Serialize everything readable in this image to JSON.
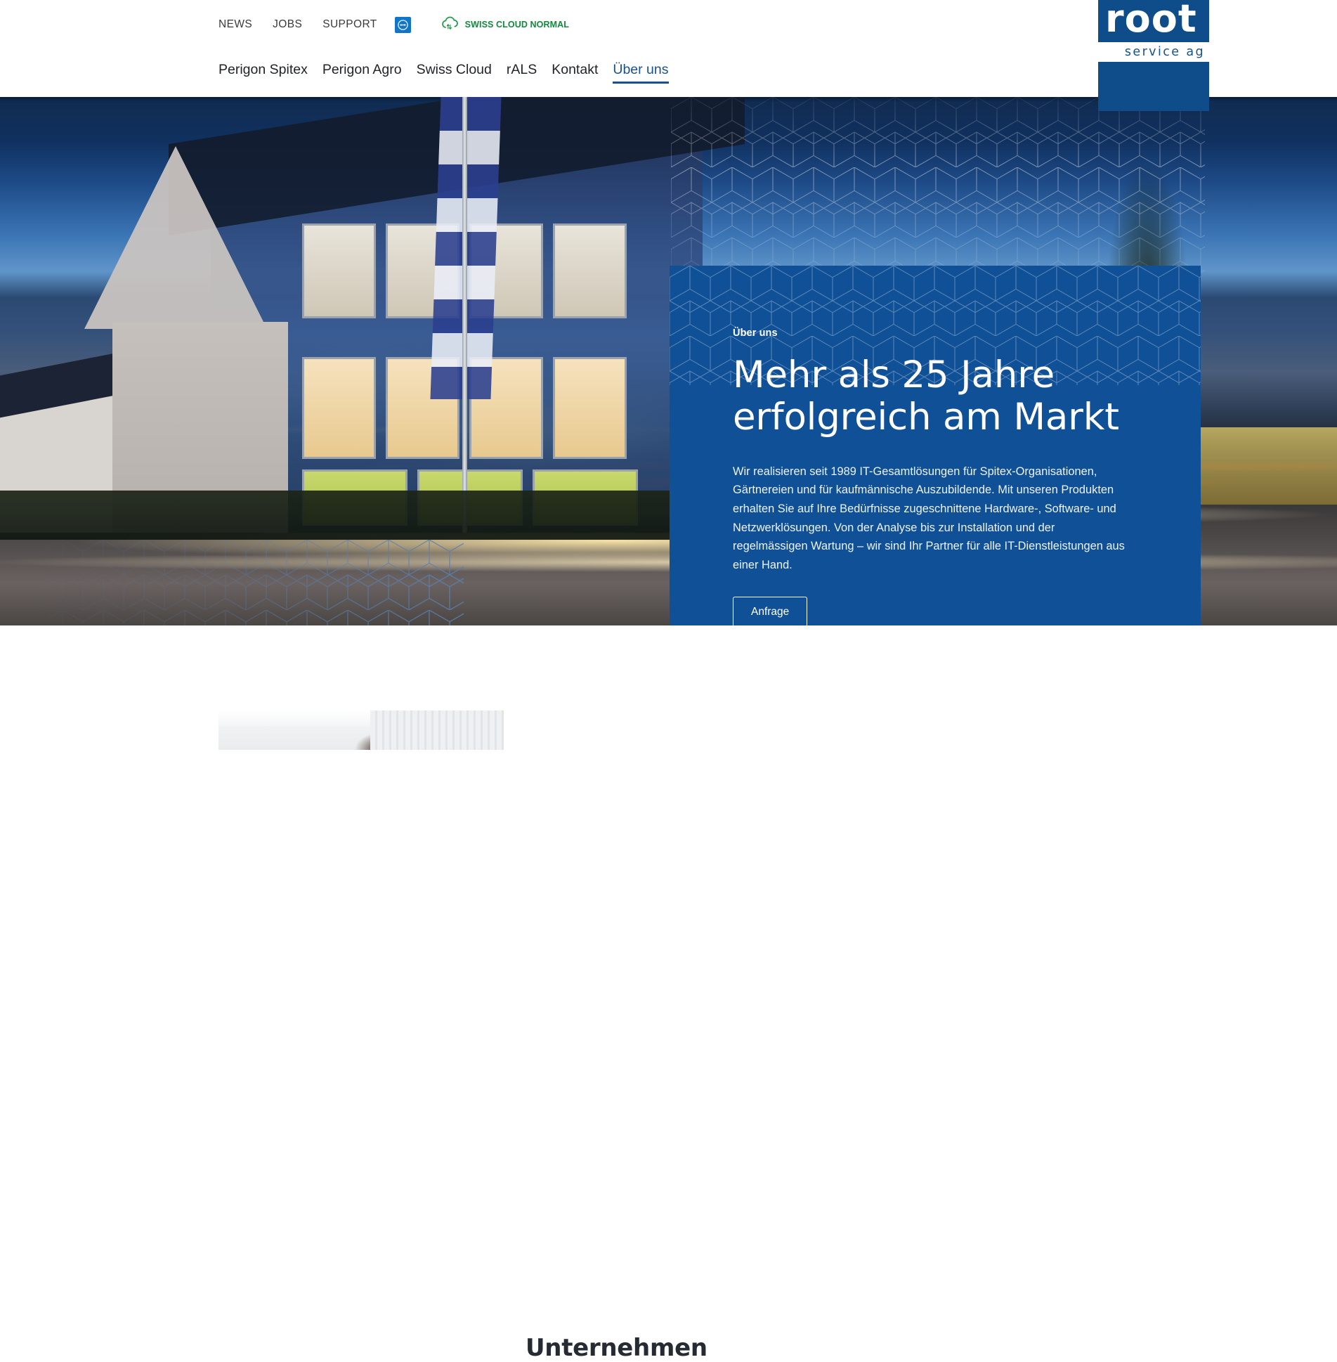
{
  "header": {
    "utility_links": [
      {
        "label": "NEWS"
      },
      {
        "label": "JOBS"
      },
      {
        "label": "SUPPORT"
      }
    ],
    "teamviewer_icon": "teamviewer-icon",
    "cloud_status": {
      "icon": "cloud-sync-icon",
      "label": "SWISS CLOUD NORMAL",
      "color": "#128A3C"
    },
    "nav_items": [
      {
        "label": "Perigon Spitex",
        "active": false
      },
      {
        "label": "Perigon Agro",
        "active": false
      },
      {
        "label": "Swiss Cloud",
        "active": false
      },
      {
        "label": "rALS",
        "active": false
      },
      {
        "label": "Kontakt",
        "active": false
      },
      {
        "label": "Über uns",
        "active": true
      }
    ],
    "logo": {
      "wordmark": "root",
      "subtitle": "service ag",
      "brand_color": "#0f4c8a"
    }
  },
  "hero": {
    "eyebrow": "Über uns",
    "title": "Mehr als 25 Jahre erfolgreich am Markt",
    "body": "Wir realisieren seit 1989 IT-Gesamtlösungen für Spitex-Organisationen, Gärtnereien und für kaufmännische Auszubildende. Mit unseren Produkten erhalten Sie auf Ihre Bedürfnisse zugeschnittene Hardware-, Software- und Netzwerklösungen. Von der Analyse bis zur Installation und der regelmässigen Wartung – wir sind Ihr Partner für alle IT-Dienstleistungen aus einer Hand.",
    "cta_label": "Anfrage",
    "panel_color": "#0f5096"
  },
  "section": {
    "title": "Unternehmen"
  }
}
